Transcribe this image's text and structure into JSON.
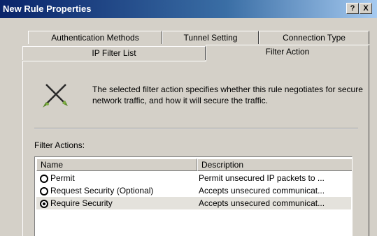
{
  "window": {
    "title": "New Rule Properties",
    "help_label": "?",
    "close_label": "X"
  },
  "tabs": {
    "back_row": [
      "Authentication Methods",
      "Tunnel Setting",
      "Connection Type"
    ],
    "front_row": [
      "IP Filter List",
      "Filter Action"
    ],
    "active": "Filter Action"
  },
  "panel": {
    "description": "The selected filter action specifies whether this rule negotiates for secure network traffic, and how it will secure the traffic.",
    "filter_actions_label": "Filter Actions:",
    "list": {
      "columns": [
        "Name",
        "Description"
      ],
      "rows": [
        {
          "name": "Permit",
          "description": "Permit unsecured IP packets to ...",
          "selected": false
        },
        {
          "name": "Request Security (Optional)",
          "description": "Accepts unsecured communicat...",
          "selected": false
        },
        {
          "name": "Require Security",
          "description": "Accepts unsecured communicat...",
          "selected": true
        }
      ]
    }
  },
  "colors": {
    "titlebar_start": "#0a246a",
    "titlebar_end": "#a6caf0",
    "window_face": "#d4d0c8"
  }
}
